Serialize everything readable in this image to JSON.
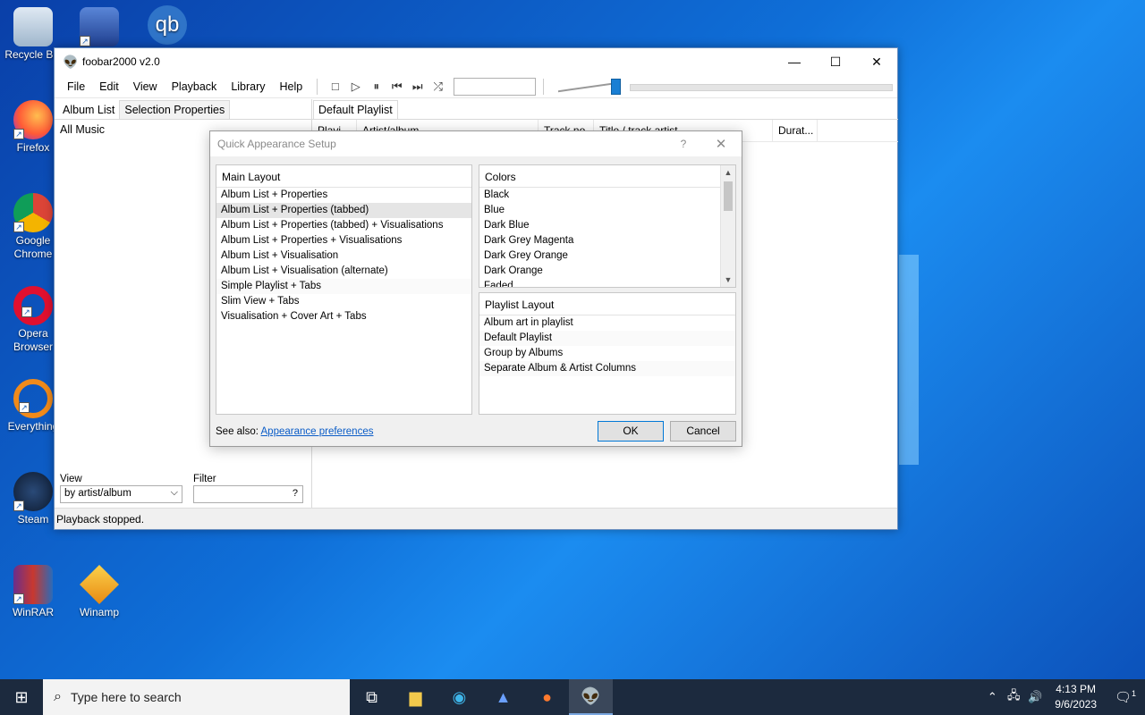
{
  "desktop": {
    "icons": [
      {
        "label": "Recycle Bin",
        "icon": "recycle-bin-icon"
      },
      {
        "label": "",
        "icon": "network-icon"
      },
      {
        "label": "",
        "icon": "qbittorrent-icon",
        "glyph": "qb"
      },
      {
        "label": "Firefox",
        "icon": "firefox-icon"
      },
      {
        "label": "Google Chrome",
        "icon": "chrome-icon"
      },
      {
        "label": "Opera Browser",
        "icon": "opera-icon"
      },
      {
        "label": "Everything",
        "icon": "everything-icon"
      },
      {
        "label": "Steam",
        "icon": "steam-icon"
      },
      {
        "label": "WinRAR",
        "icon": "winrar-icon"
      },
      {
        "label": "Winamp",
        "icon": "winamp-icon"
      }
    ]
  },
  "window": {
    "title": "foobar2000 v2.0",
    "menu": [
      "File",
      "Edit",
      "View",
      "Playback",
      "Library",
      "Help"
    ],
    "toolbar": {
      "stop": "□",
      "play": "▷",
      "pause": "⏸",
      "prev": "⏮",
      "next": "⏭",
      "random": "⤮"
    },
    "volume_fraction": 0.95,
    "left_tabs": [
      "Album List",
      "Selection Properties"
    ],
    "album_root": "All Music",
    "view_label": "View",
    "view_value": "by artist/album",
    "filter_label": "Filter",
    "filter_help": "?",
    "right_tabs": [
      "Default Playlist"
    ],
    "columns": [
      "Playi...",
      "Artist/album",
      "Track no",
      "Title / track artist",
      "Durat..."
    ],
    "status": "Playback stopped."
  },
  "dialog": {
    "title": "Quick Appearance Setup",
    "help": "?",
    "main_layout": {
      "header": "Main Layout",
      "items": [
        "Album List + Properties",
        "Album List + Properties (tabbed)",
        "Album List + Properties (tabbed) + Visualisations",
        "Album List + Properties + Visualisations",
        "Album List + Visualisation",
        "Album List + Visualisation (alternate)",
        "Simple Playlist + Tabs",
        "Slim View + Tabs",
        "Visualisation + Cover Art + Tabs"
      ],
      "selected_index": 1
    },
    "colors": {
      "header": "Colors",
      "items": [
        "Black",
        "Blue",
        "Dark Blue",
        "Dark Grey Magenta",
        "Dark Grey Orange",
        "Dark Orange",
        "Faded"
      ]
    },
    "playlist_layout": {
      "header": "Playlist Layout",
      "items": [
        "Album art in playlist",
        "Default Playlist",
        "Group by Albums",
        "Separate Album & Artist Columns"
      ]
    },
    "see_also_label": "See also:",
    "see_also_link": "Appearance preferences",
    "ok": "OK",
    "cancel": "Cancel"
  },
  "taskbar": {
    "search_placeholder": "Type here to search",
    "time": "4:13 PM",
    "date": "9/6/2023",
    "notifications": "1"
  }
}
